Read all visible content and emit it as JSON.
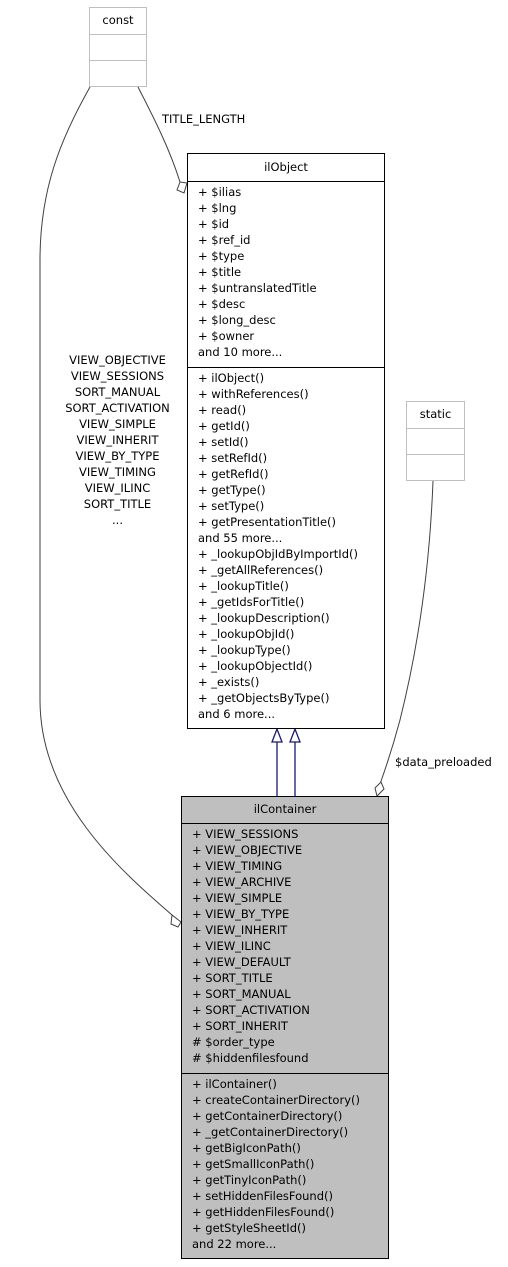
{
  "classes": {
    "const": {
      "name": "const",
      "attributes": [],
      "methods": []
    },
    "static": {
      "name": "static",
      "attributes": [],
      "methods": []
    },
    "ilObject": {
      "name": "ilObject",
      "attributes": [
        "+ $ilias",
        "+ $lng",
        "+ $id",
        "+ $ref_id",
        "+ $type",
        "+ $title",
        "+ $untranslatedTitle",
        "+ $desc",
        "+ $long_desc",
        "+ $owner",
        "and 10 more..."
      ],
      "methods": [
        "+ ilObject()",
        "+ withReferences()",
        "+ read()",
        "+ getId()",
        "+ setId()",
        "+ setRefId()",
        "+ getRefId()",
        "+ getType()",
        "+ setType()",
        "+ getPresentationTitle()",
        "and 55 more...",
        "+ _lookupObjIdByImportId()",
        "+ _getAllReferences()",
        "+ _lookupTitle()",
        "+ _getIdsForTitle()",
        "+ _lookupDescription()",
        "+ _lookupObjId()",
        "+ _lookupType()",
        "+ _lookupObjectId()",
        "+ _exists()",
        "+ _getObjectsByType()",
        "and 6 more..."
      ]
    },
    "ilContainer": {
      "name": "ilContainer",
      "attributes": [
        "+ VIEW_SESSIONS",
        "+ VIEW_OBJECTIVE",
        "+ VIEW_TIMING",
        "+ VIEW_ARCHIVE",
        "+ VIEW_SIMPLE",
        "+ VIEW_BY_TYPE",
        "+ VIEW_INHERIT",
        "+ VIEW_ILINC",
        "+ VIEW_DEFAULT",
        "+ SORT_TITLE",
        "+ SORT_MANUAL",
        "+ SORT_ACTIVATION",
        "+ SORT_INHERIT",
        "# $order_type",
        "# $hiddenfilesfound"
      ],
      "methods": [
        "+ ilContainer()",
        "+ createContainerDirectory()",
        "+ getContainerDirectory()",
        "+ _getContainerDirectory()",
        "+ getBigIconPath()",
        "+ getSmallIconPath()",
        "+ getTinyIconPath()",
        "+ setHiddenFilesFound()",
        "+ getHiddenFilesFound()",
        "+ getStyleSheetId()",
        "and 22 more..."
      ]
    }
  },
  "edges": {
    "const_to_ilObject": {
      "label": "TITLE_LENGTH",
      "type": "usage"
    },
    "const_to_ilContainer": {
      "type": "usage",
      "labels": [
        "VIEW_OBJECTIVE",
        "VIEW_SESSIONS",
        "SORT_MANUAL",
        "SORT_ACTIVATION",
        "VIEW_SIMPLE",
        "VIEW_INHERIT",
        "VIEW_BY_TYPE",
        "VIEW_TIMING",
        "VIEW_ILINC",
        "SORT_TITLE",
        "..."
      ]
    },
    "static_to_ilContainer": {
      "label": "$data_preloaded",
      "type": "usage"
    },
    "ilContainer_inherits_ilObject": {
      "type": "inheritance",
      "count": 2
    }
  },
  "colors": {
    "focus_fill": "#bfbfbf",
    "ghost_border": "#bfbfbf",
    "inheritance_edge": "#191970",
    "usage_edge": "#404040"
  }
}
